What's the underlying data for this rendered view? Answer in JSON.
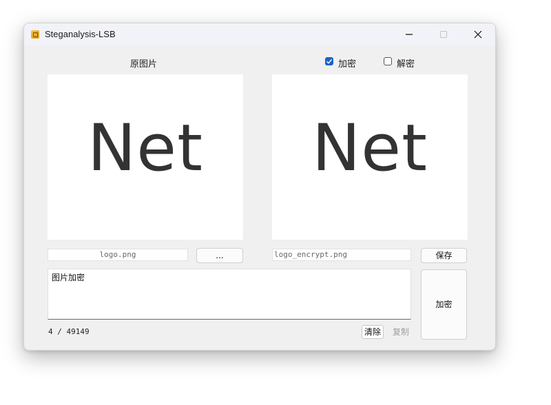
{
  "window": {
    "title": "Steganalysis-LSB"
  },
  "icons": {
    "app": "app-icon",
    "minimize": "minimize-icon",
    "maximize": "maximize-icon",
    "close": "close-icon"
  },
  "labels": {
    "original_image": "原图片"
  },
  "mode": {
    "encrypt_label": "加密",
    "encrypt_checked": true,
    "decrypt_label": "解密",
    "decrypt_checked": false
  },
  "images": {
    "original_text": "Net",
    "result_text": "Net"
  },
  "files": {
    "source_name": "logo.png",
    "output_name": "logo_encrypt.png"
  },
  "buttons": {
    "browse": "...",
    "save": "保存",
    "run": "加密",
    "clear": "清除",
    "copy": "复制"
  },
  "message": {
    "text": "图片加密",
    "counter": "4 / 49149"
  },
  "colors": {
    "accent": "#1a63c5",
    "window_bg": "#f0f0f0",
    "titlebar_bg": "#f2f3f9"
  }
}
